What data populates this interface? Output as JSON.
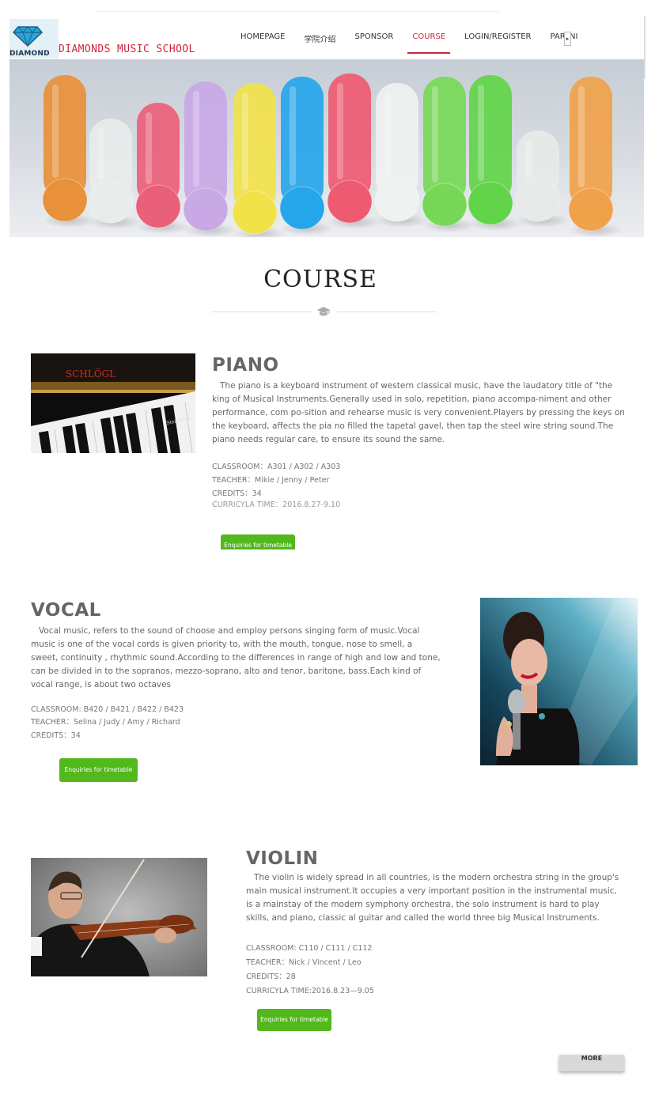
{
  "brand": {
    "logo_word": "DIAMOND",
    "school_name": "DIAMONDS MUSIC SCHOOL",
    "accent_color": "#d0253b"
  },
  "nav": {
    "items": [
      {
        "label": "HOMEPAGE",
        "active": false
      },
      {
        "label": "学院介绍",
        "active": false
      },
      {
        "label": "SPONSOR",
        "active": false
      },
      {
        "label": "COURSE",
        "active": true
      },
      {
        "label": "LOGIN/REGISTER",
        "active": false
      },
      {
        "label": "PARTNI",
        "active": false
      }
    ],
    "more_arrow": "▸"
  },
  "section": {
    "title": "COURSE",
    "icon": "graduation-cap-icon"
  },
  "courses": [
    {
      "name": "PIANO",
      "description": "The piano is a keyboard instrument of western classical music, have the laudatory title of \"the king of Musical Instruments.Generally used in solo, repetition, piano accompa-niment and other performance, com po-sition and rehearse music is very convenient.Players by pressing the keys on the keyboard, affects the pia no filled the tapetal gavel, then tap the steel wire string sound.The piano needs regular care, to ensure its sound the same.",
      "classroom": "CLASSROOM：A301 / A302 / A303",
      "teacher": "TEACHER：Mikie / Jenny / Peter",
      "credits": "CREDITS：34",
      "time": "CURRICYLA TIME：2016.8.27-9.10",
      "button": "Enquiries for timetable",
      "image_label": "SCHLÖGL"
    },
    {
      "name": "VOCAL",
      "description": "Vocal music, refers to the sound of choose and employ persons singing form of music.Vocal music is one of the vocal cords is given priority to, with the mouth, tongue, nose to smell, a sweet, continuity , rhythmic sound.According to the differences in range of high and low and tone, can be divided in to the sopranos, mezzo-soprano, alto and tenor, baritone, bass.Each kind of vocal range, is about two octaves",
      "classroom": "CLASSROOM: B420 / B421 / B422 / B423",
      "teacher": "TEACHER：Selina / Judy / Amy / Richard",
      "credits": "CREDITS：34",
      "button": "Enquiries for timetable"
    },
    {
      "name": "VIOLIN",
      "description": "The violin is widely spread in all countries, is the modern orchestra string in the group's main musical instrument.It occupies a very important position in the instrumental music, is a mainstay of the modern symphony orchestra, the solo instrument is hard to play skills, and piano, classic al guitar and called the world three big Musical Instruments.",
      "classroom": "CLASSROOM: C110 / C111 / C112",
      "teacher": "TEACHER：Nick / Vincent / Leo",
      "credits": "CREDITS：28",
      "time": "CURRICYLA TIME:2016.8.23—9.05",
      "button": "Enquiries for timetable"
    }
  ],
  "more_button": "MORE",
  "colors": {
    "button_green": "#52b81c",
    "title_gray": "#666666"
  }
}
